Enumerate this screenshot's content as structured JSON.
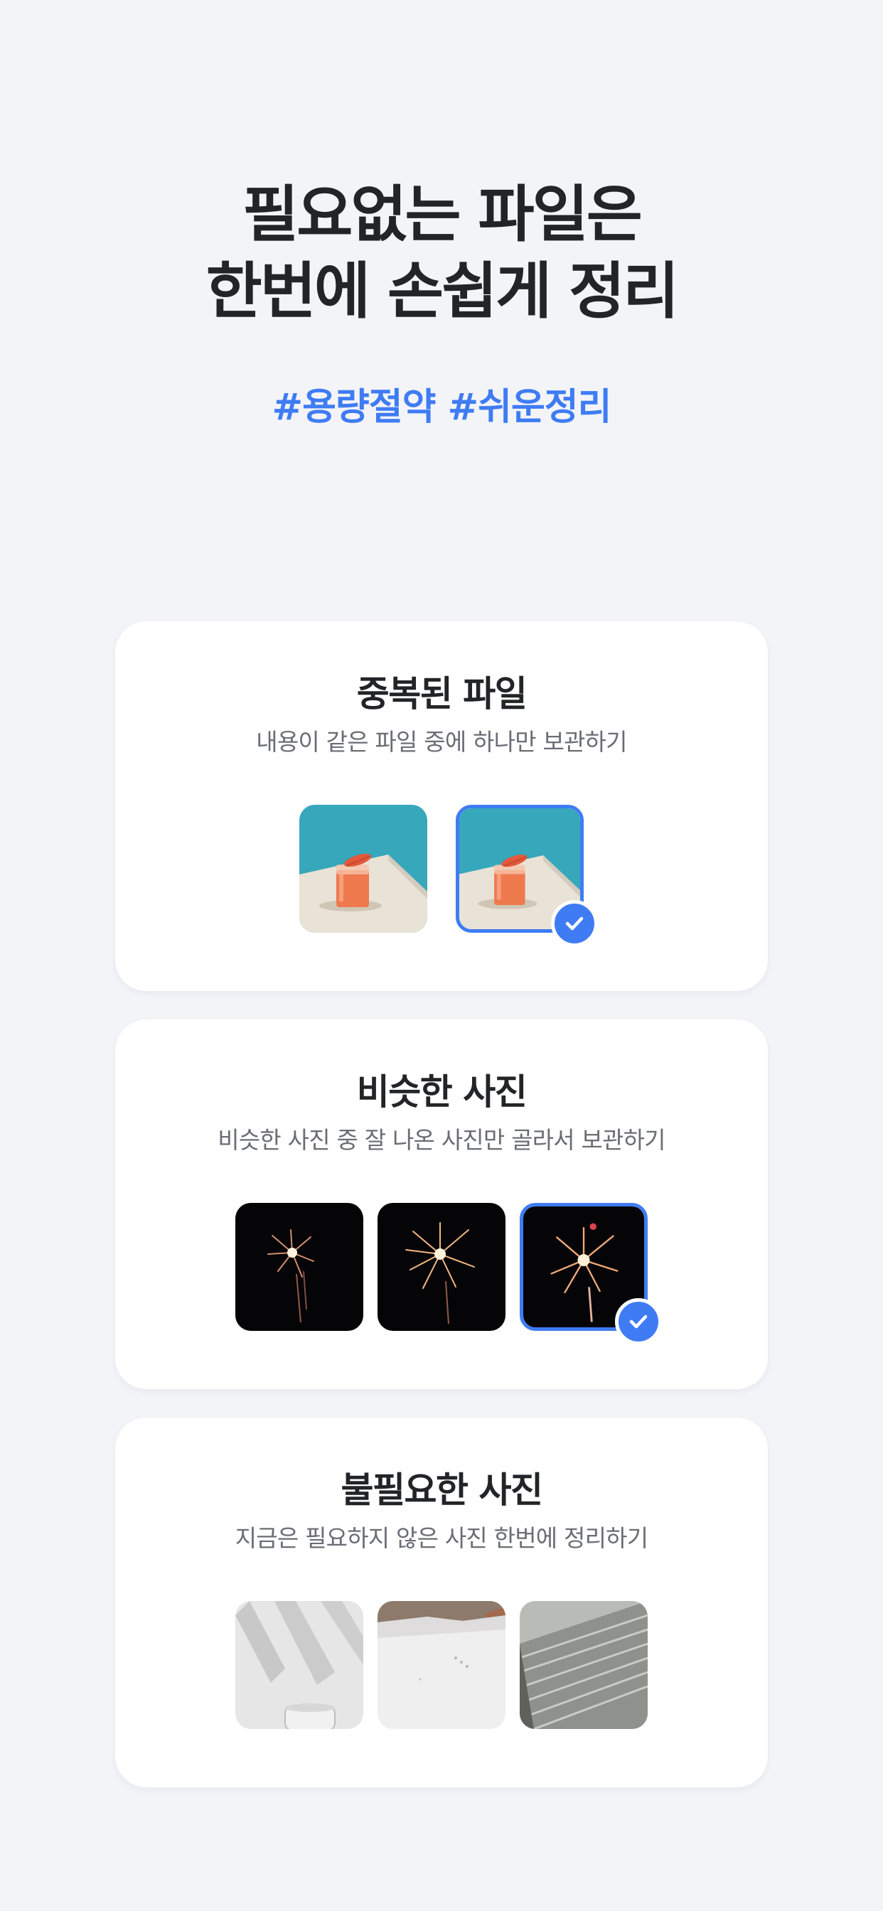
{
  "hero": {
    "title_line1": "필요없는 파일은",
    "title_line2": "한번에 손쉽게 정리",
    "tags": "#용량절약 #쉬운정리"
  },
  "cards": [
    {
      "title": "중복된 파일",
      "description": "내용이 같은 파일 중에 하나만 보관하기",
      "thumbnails": [
        {
          "subject": "orange-drink-photo",
          "selected": false
        },
        {
          "subject": "orange-drink-photo",
          "selected": true
        }
      ]
    },
    {
      "title": "비슷한 사진",
      "description": "비슷한 사진 중 잘 나온 사진만 골라서 보관하기",
      "thumbnails": [
        {
          "subject": "fireworks-photo",
          "selected": false
        },
        {
          "subject": "fireworks-photo",
          "selected": false
        },
        {
          "subject": "fireworks-photo",
          "selected": true
        }
      ]
    },
    {
      "title": "불필요한 사진",
      "description": "지금은 필요하지 않은 사진 한번에 정리하기",
      "thumbnails": [
        {
          "subject": "wall-shadow-photo",
          "selected": false
        },
        {
          "subject": "snow-photo",
          "selected": false
        },
        {
          "subject": "building-photo",
          "selected": false
        }
      ]
    }
  ],
  "colors": {
    "background": "#f3f4f8",
    "accent": "#3f7cf4",
    "card": "#ffffff",
    "title_text": "#222428",
    "description_text": "#6a6d74"
  },
  "icons": {
    "selected_badge": "check-icon"
  }
}
